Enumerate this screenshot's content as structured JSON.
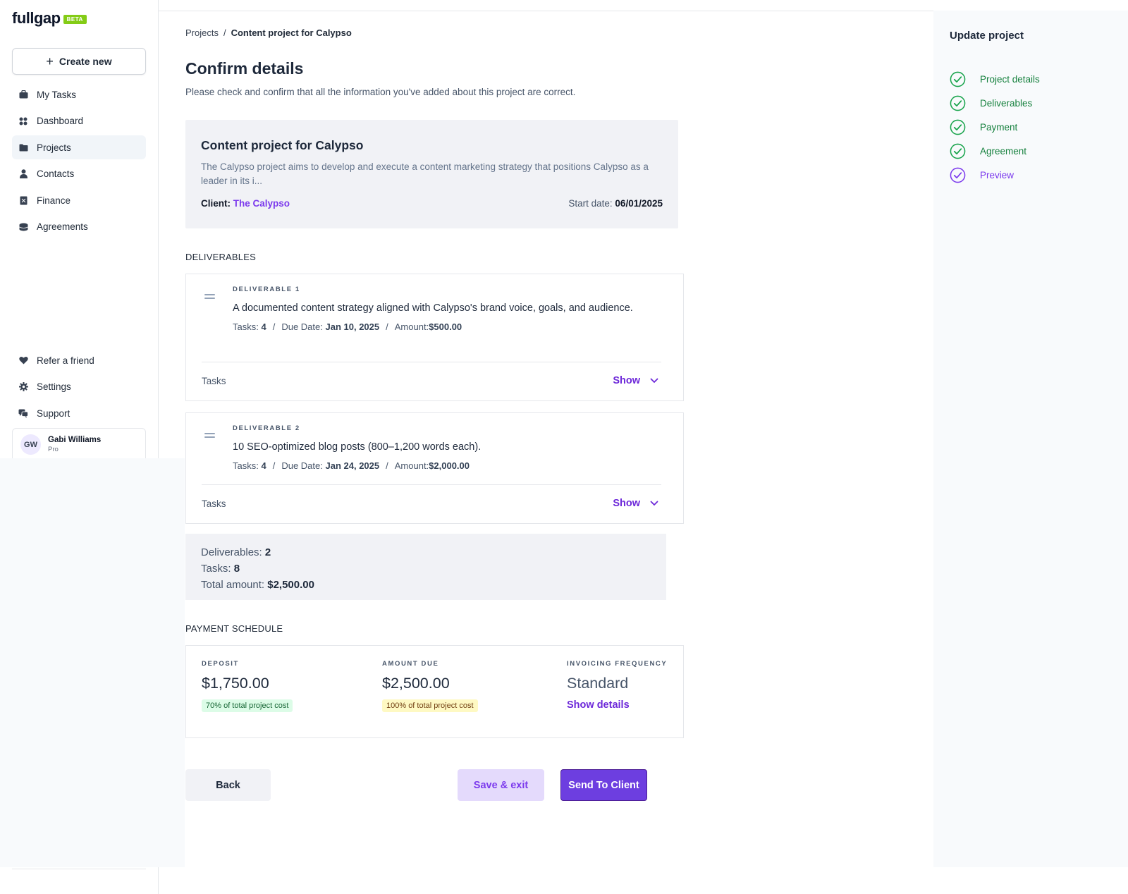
{
  "app": {
    "logo_text": "fullgap",
    "beta_badge": "BETA"
  },
  "sidebar": {
    "create_new_label": "Create new",
    "items": [
      {
        "label": "My Tasks",
        "icon": "briefcase-icon"
      },
      {
        "label": "Dashboard",
        "icon": "grid-icon"
      },
      {
        "label": "Projects",
        "icon": "folder-icon",
        "active": true
      },
      {
        "label": "Contacts",
        "icon": "user-icon"
      },
      {
        "label": "Finance",
        "icon": "receipt-icon"
      },
      {
        "label": "Agreements",
        "icon": "stack-icon"
      }
    ],
    "bottom_items": [
      {
        "label": "Refer a friend",
        "icon": "heart-icon"
      },
      {
        "label": "Settings",
        "icon": "gear-icon"
      },
      {
        "label": "Support",
        "icon": "chat-icon"
      }
    ],
    "user": {
      "initials": "GW",
      "name": "Gabi Williams",
      "plan": "Pro"
    }
  },
  "breadcrumb": {
    "root": "Projects",
    "separator": "/",
    "current": "Content project for Calypso"
  },
  "page": {
    "title": "Confirm details",
    "subtitle": "Please check and confirm that all the information you've added about this project are correct."
  },
  "project": {
    "name": "Content project for Calypso",
    "description": "The Calypso project aims to develop and execute a content marketing strategy that positions Calypso as a leader in its i...",
    "client_label": "Client:",
    "client_name": "The Calypso",
    "start_label": "Start date:",
    "start_date": "06/01/2025"
  },
  "deliverables_section": {
    "label": "DELIVERABLES",
    "items": [
      {
        "overline": "DELIVERABLE 1",
        "title": "A documented content strategy aligned with Calypso's brand voice, goals, and audience.",
        "tasks_label": "Tasks:",
        "tasks_count": "4",
        "due_label": "Due Date:",
        "due_date": "Jan 10, 2025",
        "amount_label": "Amount:",
        "amount": "$500.00",
        "tasks_row_label": "Tasks",
        "show_label": "Show"
      },
      {
        "overline": "DELIVERABLE 2",
        "title": "10 SEO-optimized blog posts (800–1,200 words each).",
        "tasks_label": "Tasks:",
        "tasks_count": "4",
        "due_label": "Due Date:",
        "due_date": "Jan 24, 2025",
        "amount_label": "Amount:",
        "amount": "$2,000.00",
        "tasks_row_label": "Tasks",
        "show_label": "Show"
      }
    ],
    "meta_separator": "/"
  },
  "summary": {
    "deliverables_label": "Deliverables:",
    "deliverables_value": "2",
    "tasks_label": "Tasks:",
    "tasks_value": "8",
    "total_label": "Total amount:",
    "total_value": "$2,500.00"
  },
  "payment": {
    "label": "PAYMENT SCHEDULE",
    "deposit_label": "DEPOSIT",
    "deposit_value": "$1,750.00",
    "deposit_pill": "70% of total project cost",
    "amount_due_label": "AMOUNT DUE",
    "amount_due_value": "$2,500.00",
    "amount_due_pill": "100% of total project cost",
    "frequency_label": "INVOICING FREQUENCY",
    "frequency_value": "Standard",
    "show_details_label": "Show details"
  },
  "actions": {
    "back": "Back",
    "save_exit": "Save & exit",
    "send": "Send To Client"
  },
  "right_panel": {
    "title": "Update project",
    "steps": [
      {
        "label": "Project details",
        "status": "done"
      },
      {
        "label": "Deliverables",
        "status": "done"
      },
      {
        "label": "Payment",
        "status": "done"
      },
      {
        "label": "Agreement",
        "status": "done"
      },
      {
        "label": "Preview",
        "status": "current"
      }
    ]
  },
  "colors": {
    "accent": "#6d28d9",
    "success": "#15803d",
    "beta": "#84cc16"
  }
}
